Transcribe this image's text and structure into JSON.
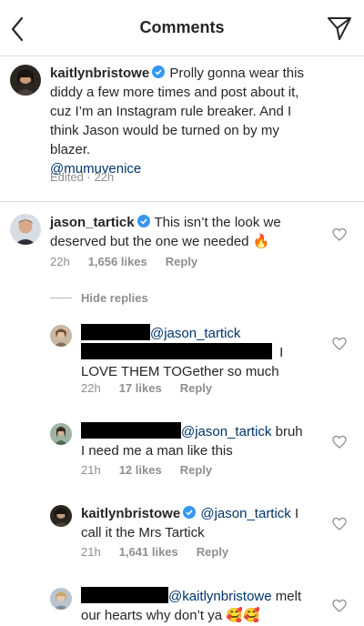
{
  "header": {
    "title": "Comments",
    "back_icon": "back-chevron-icon",
    "send_icon": "direct-send-icon"
  },
  "caption": {
    "username": "kaitlynbristowe",
    "text": "Prolly gonna wear this diddy a few more times and post about it, cuz I’m an Instagram rule breaker. And I think Jason would be turned on by my blazer.",
    "mention": "@mumuvenice",
    "edited": "Edited",
    "time": "22h"
  },
  "comment1": {
    "username": "jason_tartick",
    "text": "This isn’t the look we deserved but the one we needed",
    "emoji": "🔥",
    "time": "22h",
    "likes": "1,656 likes",
    "reply": "Reply"
  },
  "hide_replies": "Hide replies",
  "reply1": {
    "mention": "@jason_tartick",
    "text_a": "I",
    "text_b": "LOVE THEM TOGether so much",
    "time": "22h",
    "likes": "17 likes",
    "reply": "Reply"
  },
  "reply2": {
    "mention": "@jason_tartick",
    "text_a": "bruh",
    "text_b": "I need me a man like this",
    "time": "21h",
    "likes": "12 likes",
    "reply": "Reply"
  },
  "reply3": {
    "username": "kaitlynbristowe",
    "mention": "@jason_tartick",
    "text_a": "I",
    "text_b": "call it the Mrs Tartick",
    "time": "21h",
    "likes": "1,641 likes",
    "reply": "Reply"
  },
  "reply4": {
    "mention": "@kaitlynbristowe",
    "text_a": "melt",
    "text_b": "our hearts why don’t ya",
    "emoji": "🥰🥰"
  },
  "colors": {
    "mention": "#003569",
    "secondary": "#8e8e8e",
    "verified": "#3897f0",
    "divider": "#dbdbdb"
  }
}
